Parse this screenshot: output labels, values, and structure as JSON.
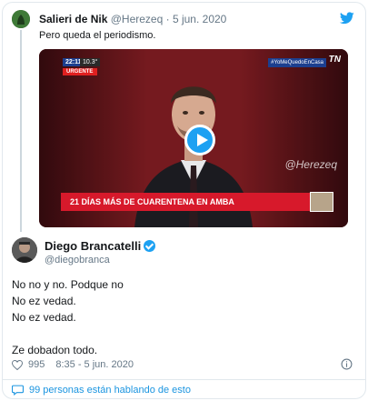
{
  "parent_tweet": {
    "display_name": "Salieri de Nik",
    "handle": "@Herezeq",
    "separator": "·",
    "date": "5 jun. 2020",
    "text": "Pero queda el periodismo."
  },
  "video": {
    "time_badge": "22:11",
    "temp_badge": "10.3°",
    "urgent_label": "URGENTE",
    "hashtag": "#YoMeQuedoEnCasa",
    "channel_logo": "TN",
    "watermark": "@Herezeq",
    "banner_text": "21 DÍAS MÁS DE CUARENTENA EN AMBA"
  },
  "main_tweet": {
    "display_name": "Diego Brancatelli",
    "handle": "@diegobranca",
    "lines": [
      "No no y no. Podque no",
      "No ez vedad.",
      "No ez vedad.",
      "Ze dobadon todo."
    ],
    "likes": "995",
    "timestamp": "8:35 - 5 jun. 2020"
  },
  "conversation": {
    "label": "99 personas están hablando de esto"
  },
  "colors": {
    "accent": "#1da1f2",
    "link": "#1b95e0",
    "muted": "#657786",
    "banner_red": "#d7192b"
  },
  "icons": [
    "twitter-bird-icon",
    "play-icon",
    "verified-badge-icon",
    "heart-icon",
    "info-icon",
    "comment-bubble-icon"
  ]
}
